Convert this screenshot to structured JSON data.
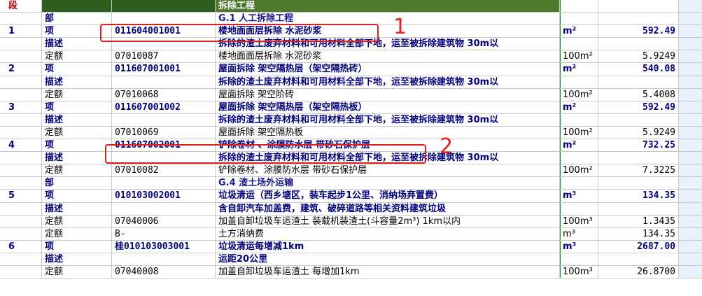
{
  "header": {
    "level": "段",
    "title": "拆除工程"
  },
  "rows": [
    {
      "no": "",
      "type": "部",
      "code": "",
      "name": "G.1  人工拆除工程",
      "unit": "",
      "qty": "",
      "style": "section"
    },
    {
      "no": "1",
      "type": "项",
      "code": "011604001001",
      "name": "楼地面面层拆除  水泥砂浆",
      "unit": "m²",
      "qty": "592.49",
      "style": "item"
    },
    {
      "no": "",
      "type": "描述",
      "code": "",
      "name": "拆除的渣土废弃材料和可用材料全部下地，运至被拆除建筑物  30m以",
      "unit": "",
      "qty": "",
      "style": "desc"
    },
    {
      "no": "",
      "type": "定额",
      "code": "07010087",
      "name": "楼地面面层拆除  水泥砂浆",
      "unit": "100m²",
      "qty": "5.9249",
      "style": "quota"
    },
    {
      "no": "2",
      "type": "项",
      "code": "011607001001",
      "name": "屋面拆除  架空隔热层（架空隔热砖）",
      "unit": "m²",
      "qty": "540.08",
      "style": "item"
    },
    {
      "no": "",
      "type": "描述",
      "code": "",
      "name": "拆除的渣土废弃材料和可用材料全部下地，运至被拆除建筑物  30m以",
      "unit": "",
      "qty": "",
      "style": "desc"
    },
    {
      "no": "",
      "type": "定额",
      "code": "07010068",
      "name": "屋面拆除  架空阶砖",
      "unit": "100m²",
      "qty": "5.4008",
      "style": "quota"
    },
    {
      "no": "3",
      "type": "项",
      "code": "011607001002",
      "name": "屋面拆除  架空隔热层（架空隔热板）",
      "unit": "m²",
      "qty": "592.49",
      "style": "item"
    },
    {
      "no": "",
      "type": "描述",
      "code": "",
      "name": "拆除的渣土废弃材料和可用材料全部下地，运至被拆除建筑物  30m以",
      "unit": "",
      "qty": "",
      "style": "desc"
    },
    {
      "no": "",
      "type": "定额",
      "code": "07010069",
      "name": "屋面拆除  架空隔热板",
      "unit": "100m²",
      "qty": "5.9249",
      "style": "quota"
    },
    {
      "no": "4",
      "type": "项",
      "code": "011607002001",
      "name": "铲除卷材  、涂膜防水层  带砂石保护层",
      "unit": "m²",
      "qty": "732.25",
      "style": "item"
    },
    {
      "no": "",
      "type": "描述",
      "code": "",
      "name": "拆除的渣土废弃材料和可用材料全部下地，运至被拆除建筑物  30m以",
      "unit": "",
      "qty": "",
      "style": "desc"
    },
    {
      "no": "",
      "type": "定额",
      "code": "07010082",
      "name": "铲除卷材、涂膜防水层  带砂石保护层",
      "unit": "100m²",
      "qty": "7.3225",
      "style": "quota"
    },
    {
      "no": "",
      "type": "部",
      "code": "",
      "name": "G.4  渣土场外运输",
      "unit": "",
      "qty": "",
      "style": "section"
    },
    {
      "no": "5",
      "type": "项",
      "code": "010103002001",
      "name": "垃圾清运（西乡塘区，装车起步1公里、消纳场弃置费）",
      "unit": "m³",
      "qty": "134.35",
      "style": "item"
    },
    {
      "no": "",
      "type": "描述",
      "code": "",
      "name": "含自卸汽车加盖费，建筑、破碎道路等相关资料建筑垃圾",
      "unit": "",
      "qty": "",
      "style": "desc"
    },
    {
      "no": "",
      "type": "定额",
      "code": "07040006",
      "name": "加盖自卸垃圾车运渣土  装载机装渣土(斗容量2m³)  1km以内",
      "unit": "100m³",
      "qty": "1.3435",
      "style": "quota"
    },
    {
      "no": "",
      "type": "定额",
      "code": "B-",
      "name": "土方消纳费",
      "unit": "m³",
      "qty": "134.35",
      "style": "quota"
    },
    {
      "no": "6",
      "type": "项",
      "code": "桂010103003001",
      "name": "垃圾清运每增减1km",
      "unit": "m³",
      "qty": "2687.00",
      "style": "item"
    },
    {
      "no": "",
      "type": "描述",
      "code": "",
      "name": "运距20公里",
      "unit": "",
      "qty": "",
      "style": "desc"
    },
    {
      "no": "",
      "type": "定额",
      "code": "07040008",
      "name": "加盖自卸垃圾车运渣土  每增加1km",
      "unit": "100m³",
      "qty": "26.8700",
      "style": "quota"
    }
  ],
  "annotations": {
    "label_1": "1",
    "label_2": "2"
  }
}
